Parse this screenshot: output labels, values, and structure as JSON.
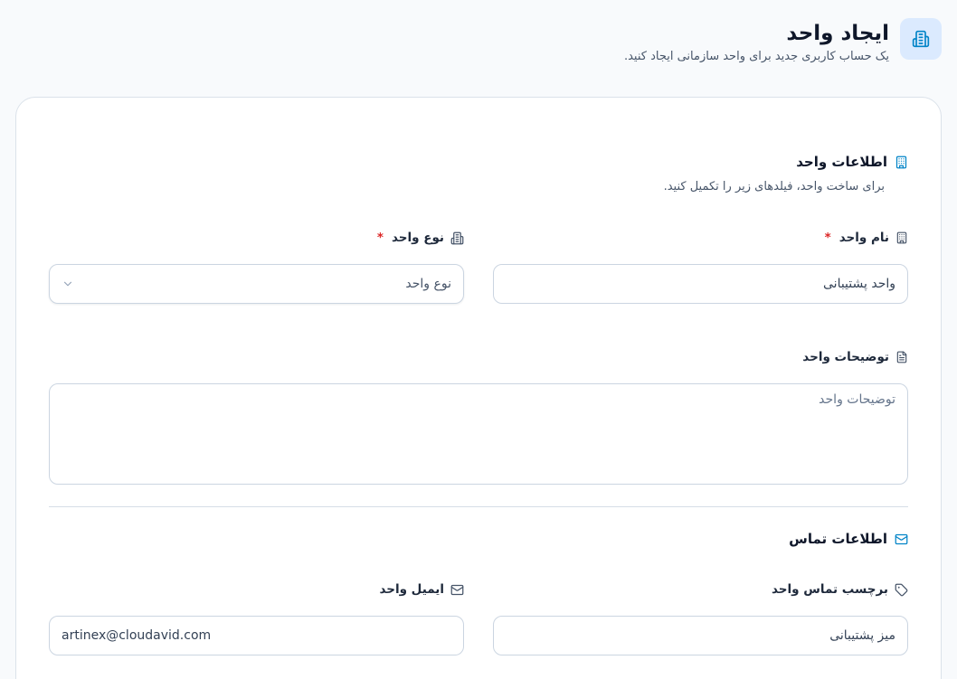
{
  "header": {
    "title": "ایجاد واحد",
    "subtitle": "یک حساب کاربری جدید برای واحد سازمانی ایجاد کنید.",
    "icon": "buildings-icon"
  },
  "unit_info": {
    "title": "اطلاعات واحد",
    "description": "برای ساخت واحد، فیلدهای زیر را تکمیل کنید.",
    "icon": "building-icon",
    "name_field": {
      "label": "نام واحد",
      "required_mark": "*",
      "value": "واحد پشتیبانی",
      "icon": "building-icon"
    },
    "type_field": {
      "label": "نوع واحد",
      "required_mark": "*",
      "placeholder": "نوع واحد",
      "icon": "buildings-icon"
    },
    "description_field": {
      "label": "توضیحات واحد",
      "placeholder": "توضیحات واحد",
      "icon": "document-icon"
    }
  },
  "contact_info": {
    "title": "اطلاعات تماس",
    "icon": "mail-icon",
    "tag_field": {
      "label": "برچسب تماس واحد",
      "value": "میز پشتیبانی",
      "icon": "tag-icon"
    },
    "email_field": {
      "label": "ایمیل واحد",
      "value": "artinex@cloudavid.com",
      "icon": "mail-icon"
    }
  },
  "colors": {
    "accent": "#0284c7",
    "required": "#dc2626",
    "icon_bg": "#dbeafe"
  }
}
